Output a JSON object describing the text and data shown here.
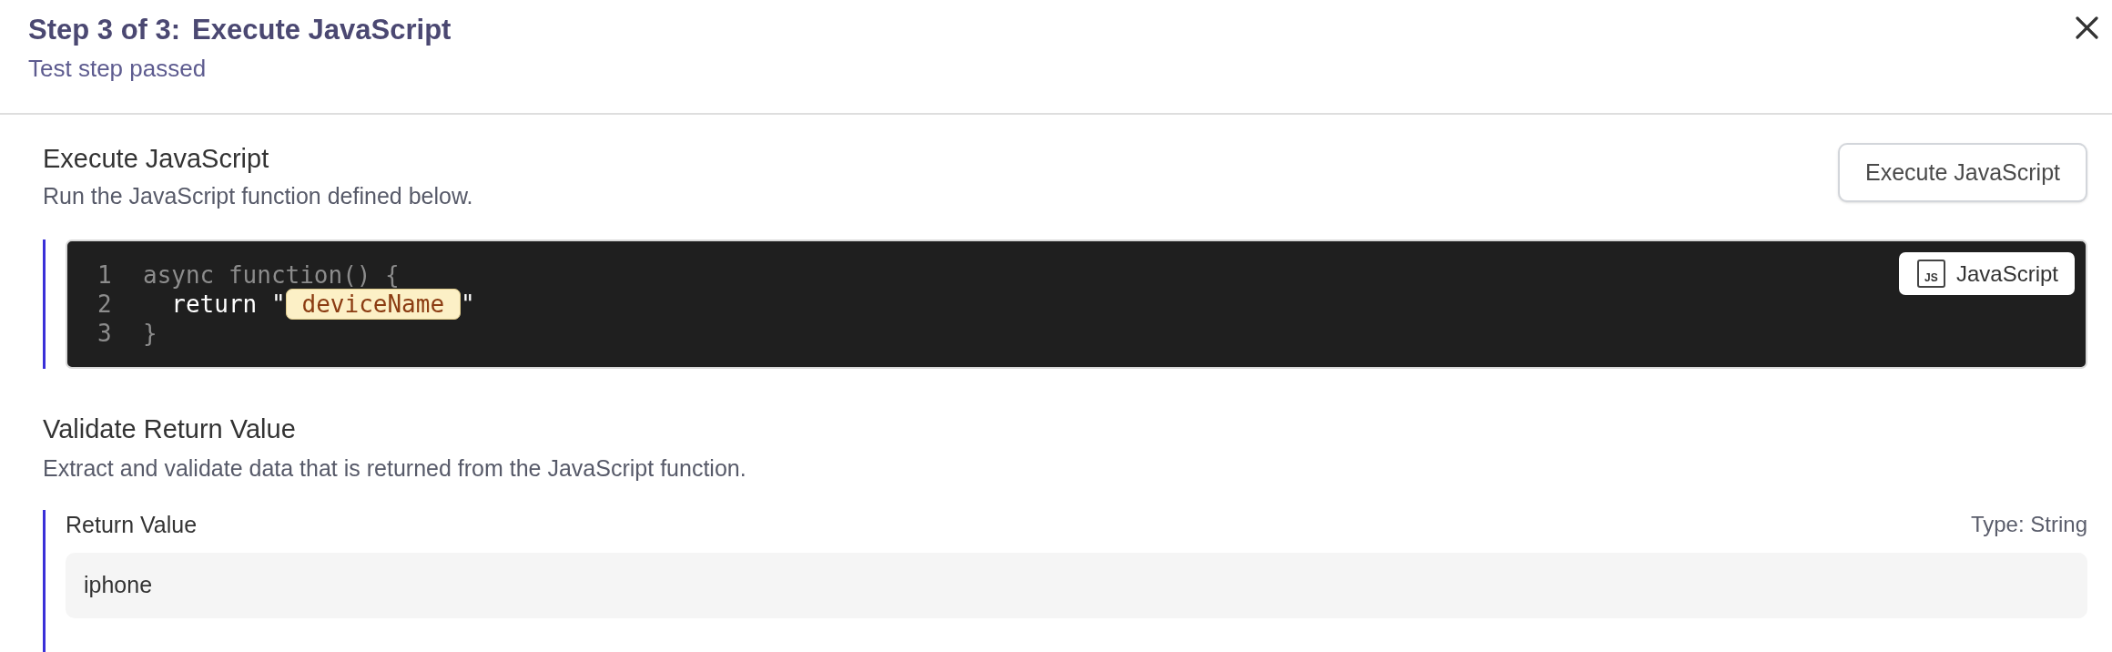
{
  "dialog": {
    "step_label": "Step 3 of 3:",
    "title": "Execute JavaScript",
    "status": "Test step passed"
  },
  "sections": [
    {
      "kind": "code",
      "title": "Execute JavaScript",
      "description": "Run the JavaScript function defined below.",
      "action_button": "Execute JavaScript",
      "editor": {
        "language_icon": "JS",
        "language": "JavaScript",
        "lines": [
          {
            "number": "1",
            "dimmed": true,
            "segments": [
              {
                "kind": "code",
                "text": "async function() {"
              }
            ]
          },
          {
            "number": "2",
            "dimmed": false,
            "segments": [
              {
                "kind": "code",
                "text": "  return \""
              },
              {
                "kind": "variable",
                "text": "deviceName"
              },
              {
                "kind": "code",
                "text": "\""
              }
            ]
          },
          {
            "number": "3",
            "dimmed": true,
            "segments": [
              {
                "kind": "code",
                "text": "}"
              }
            ]
          }
        ]
      }
    },
    {
      "kind": "validation",
      "title": "Validate Return Value",
      "description": "Extract and validate data that is returned from the JavaScript function.",
      "field": {
        "label": "Return Value",
        "type": "Type: String",
        "value": "iphone"
      }
    }
  ]
}
